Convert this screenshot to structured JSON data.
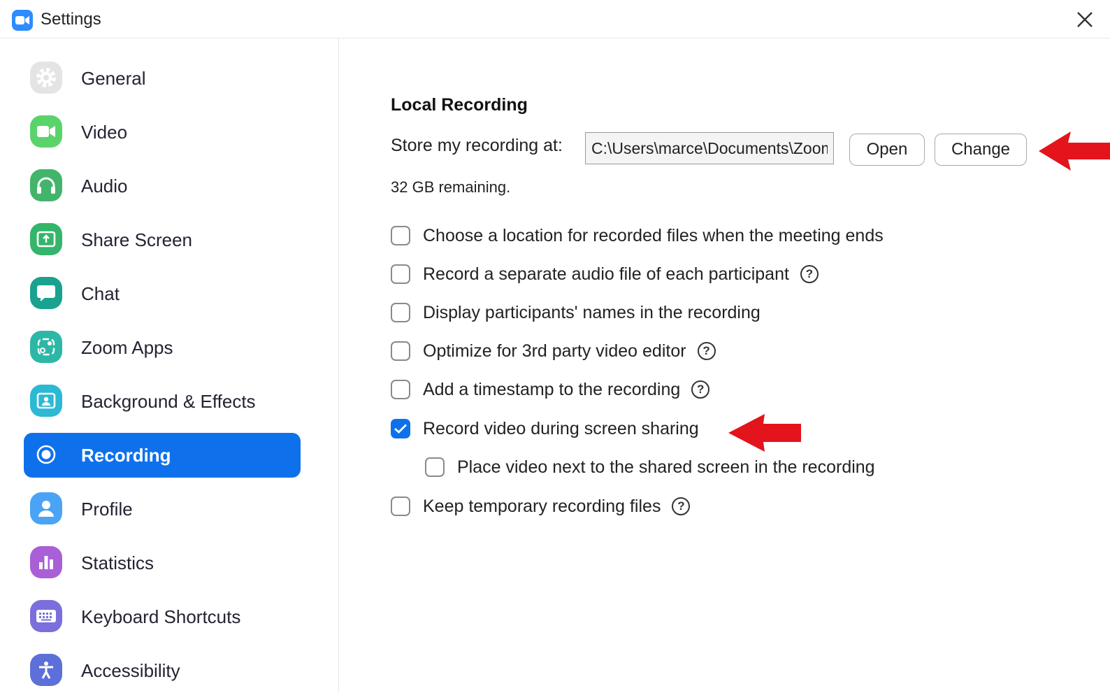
{
  "window": {
    "title": "Settings"
  },
  "sidebar": {
    "items": [
      {
        "label": "General",
        "icon": "gear-icon",
        "color": "#e6e6e6",
        "active": false
      },
      {
        "label": "Video",
        "icon": "video-camera-icon",
        "color": "#5ad36b",
        "active": false
      },
      {
        "label": "Audio",
        "icon": "headphones-icon",
        "color": "#43b46b",
        "active": false
      },
      {
        "label": "Share Screen",
        "icon": "share-screen-icon",
        "color": "#35b56b",
        "active": false
      },
      {
        "label": "Chat",
        "icon": "chat-bubble-icon",
        "color": "#1aa190",
        "active": false
      },
      {
        "label": "Zoom Apps",
        "icon": "apps-icon",
        "color": "#2db7a6",
        "active": false
      },
      {
        "label": "Background & Effects",
        "icon": "background-person-icon",
        "color": "#2bb9d3",
        "active": false
      },
      {
        "label": "Recording",
        "icon": "record-icon",
        "color": "#0e71eb",
        "active": true
      },
      {
        "label": "Profile",
        "icon": "profile-icon",
        "color": "#4aa3f5",
        "active": false
      },
      {
        "label": "Statistics",
        "icon": "bar-chart-icon",
        "color": "#a95fd6",
        "active": false
      },
      {
        "label": "Keyboard Shortcuts",
        "icon": "keyboard-icon",
        "color": "#7a6fdc",
        "active": false
      },
      {
        "label": "Accessibility",
        "icon": "accessibility-icon",
        "color": "#5d6fd8",
        "active": false
      }
    ]
  },
  "recording": {
    "section_title": "Local Recording",
    "store_label": "Store my recording at:",
    "path_value": "C:\\Users\\marce\\Documents\\Zoom",
    "open_label": "Open",
    "change_label": "Change",
    "remaining": "32 GB remaining.",
    "options": [
      {
        "label": "Choose a location for recorded files when the meeting ends",
        "checked": false,
        "help": false,
        "indent": false
      },
      {
        "label": "Record a separate audio file of each participant",
        "checked": false,
        "help": true,
        "indent": false
      },
      {
        "label": "Display participants' names in the recording",
        "checked": false,
        "help": false,
        "indent": false
      },
      {
        "label": "Optimize for 3rd party video editor",
        "checked": false,
        "help": true,
        "indent": false
      },
      {
        "label": "Add a timestamp to the recording",
        "checked": false,
        "help": true,
        "indent": false
      },
      {
        "label": "Record video during screen sharing",
        "checked": true,
        "help": false,
        "indent": false
      },
      {
        "label": "Place video next to the shared screen in the recording",
        "checked": false,
        "help": false,
        "indent": true
      },
      {
        "label": "Keep temporary recording files",
        "checked": false,
        "help": true,
        "indent": false
      }
    ],
    "help_glyph": "?"
  },
  "colors": {
    "accent": "#0e71eb",
    "annotation_arrow": "#e3141b"
  }
}
